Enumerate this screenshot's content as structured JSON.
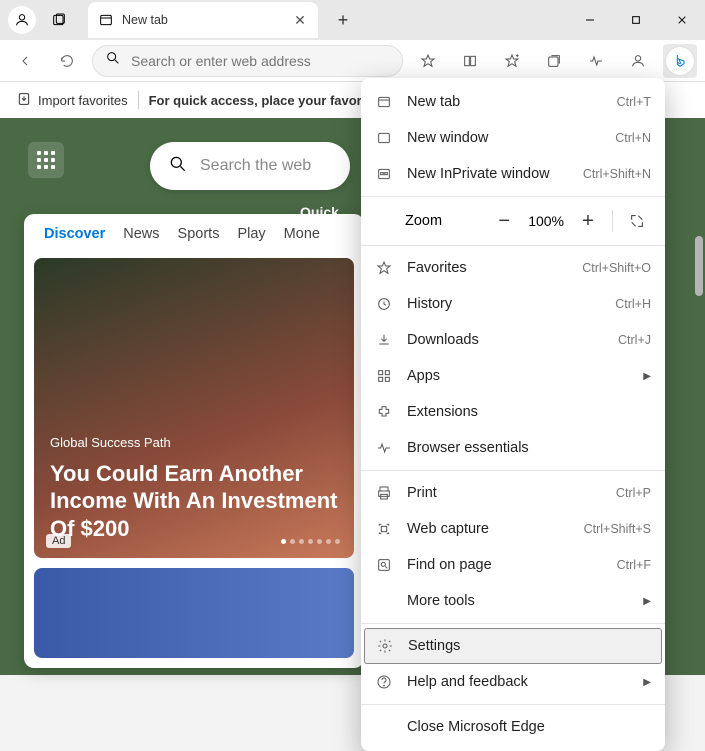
{
  "tab": {
    "title": "New tab"
  },
  "addressbar": {
    "placeholder": "Search or enter web address"
  },
  "favbar": {
    "import": "Import favorites",
    "hint": "For quick access, place your favorites"
  },
  "content": {
    "search_placeholder": "Search the web",
    "quicklinks": "Quick",
    "feed_tabs": [
      "Discover",
      "News",
      "Sports",
      "Play",
      "Mone"
    ],
    "card_label": "Global Success Path",
    "card_headline": "You Could Earn Another Income With An Investment Of $200",
    "ad": "Ad"
  },
  "menu": {
    "new_tab": {
      "label": "New tab",
      "shortcut": "Ctrl+T"
    },
    "new_window": {
      "label": "New window",
      "shortcut": "Ctrl+N"
    },
    "new_inprivate": {
      "label": "New InPrivate window",
      "shortcut": "Ctrl+Shift+N"
    },
    "zoom": {
      "label": "Zoom",
      "value": "100%"
    },
    "favorites": {
      "label": "Favorites",
      "shortcut": "Ctrl+Shift+O"
    },
    "history": {
      "label": "History",
      "shortcut": "Ctrl+H"
    },
    "downloads": {
      "label": "Downloads",
      "shortcut": "Ctrl+J"
    },
    "apps": {
      "label": "Apps"
    },
    "extensions": {
      "label": "Extensions"
    },
    "essentials": {
      "label": "Browser essentials"
    },
    "print": {
      "label": "Print",
      "shortcut": "Ctrl+P"
    },
    "capture": {
      "label": "Web capture",
      "shortcut": "Ctrl+Shift+S"
    },
    "find": {
      "label": "Find on page",
      "shortcut": "Ctrl+F"
    },
    "more_tools": {
      "label": "More tools"
    },
    "settings": {
      "label": "Settings"
    },
    "help": {
      "label": "Help and feedback"
    },
    "close": {
      "label": "Close Microsoft Edge"
    }
  }
}
